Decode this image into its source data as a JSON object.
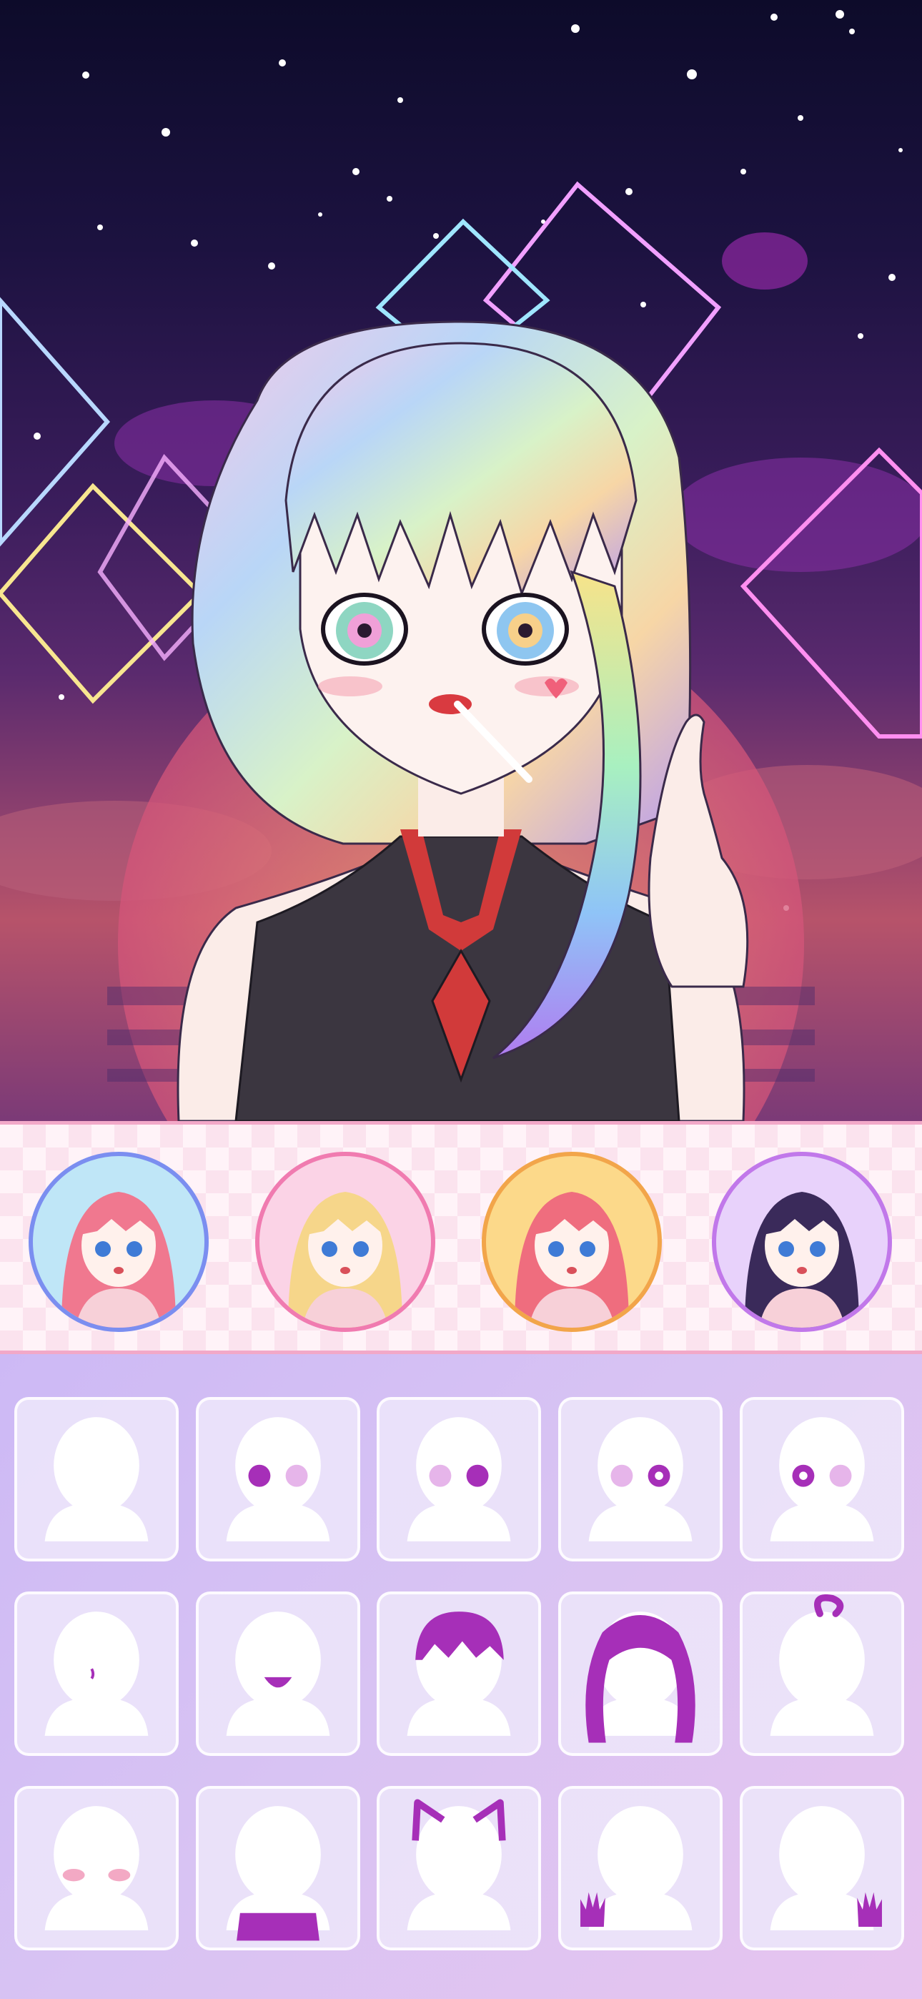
{
  "presets": [
    {
      "id": "preset-1",
      "ring": "#7b8ef0",
      "bg": "#bfe6f7",
      "hair": "#f0788f"
    },
    {
      "id": "preset-2",
      "ring": "#f07bb0",
      "bg": "#fbd3e6",
      "hair": "#f6d68a"
    },
    {
      "id": "preset-3",
      "ring": "#f2a54a",
      "bg": "#fcd98a",
      "hair": "#ef6d7e"
    },
    {
      "id": "preset-4",
      "ring": "#c178ea",
      "bg": "#e8d2fb",
      "hair": "#3a2a5a"
    }
  ],
  "category_slots": [
    {
      "id": "slot-base-body",
      "icon": "base-silhouette-icon"
    },
    {
      "id": "slot-eyes-left",
      "icon": "eyes-icon"
    },
    {
      "id": "slot-eyes-right",
      "icon": "eyes-alt-icon"
    },
    {
      "id": "slot-pupils",
      "icon": "star-pupils-icon"
    },
    {
      "id": "slot-highlights",
      "icon": "eye-highlights-icon"
    },
    {
      "id": "slot-nose",
      "icon": "nose-icon"
    },
    {
      "id": "slot-mouth",
      "icon": "mouth-icon"
    },
    {
      "id": "slot-front-hair",
      "icon": "front-hair-icon"
    },
    {
      "id": "slot-back-hair",
      "icon": "back-hair-icon"
    },
    {
      "id": "slot-ahoge",
      "icon": "ahoge-icon"
    },
    {
      "id": "slot-blush",
      "icon": "blush-icon"
    },
    {
      "id": "slot-clothes",
      "icon": "clothes-icon"
    },
    {
      "id": "slot-cat-ears",
      "icon": "cat-ears-icon"
    },
    {
      "id": "slot-left-hand",
      "icon": "left-hand-icon"
    },
    {
      "id": "slot-right-hand",
      "icon": "right-hand-icon"
    }
  ],
  "colors": {
    "accent": "#a62fb8",
    "silhouette": "#ffffff",
    "slot_bg": "#ebe4fa",
    "panel_border": "#f2a8c8"
  }
}
